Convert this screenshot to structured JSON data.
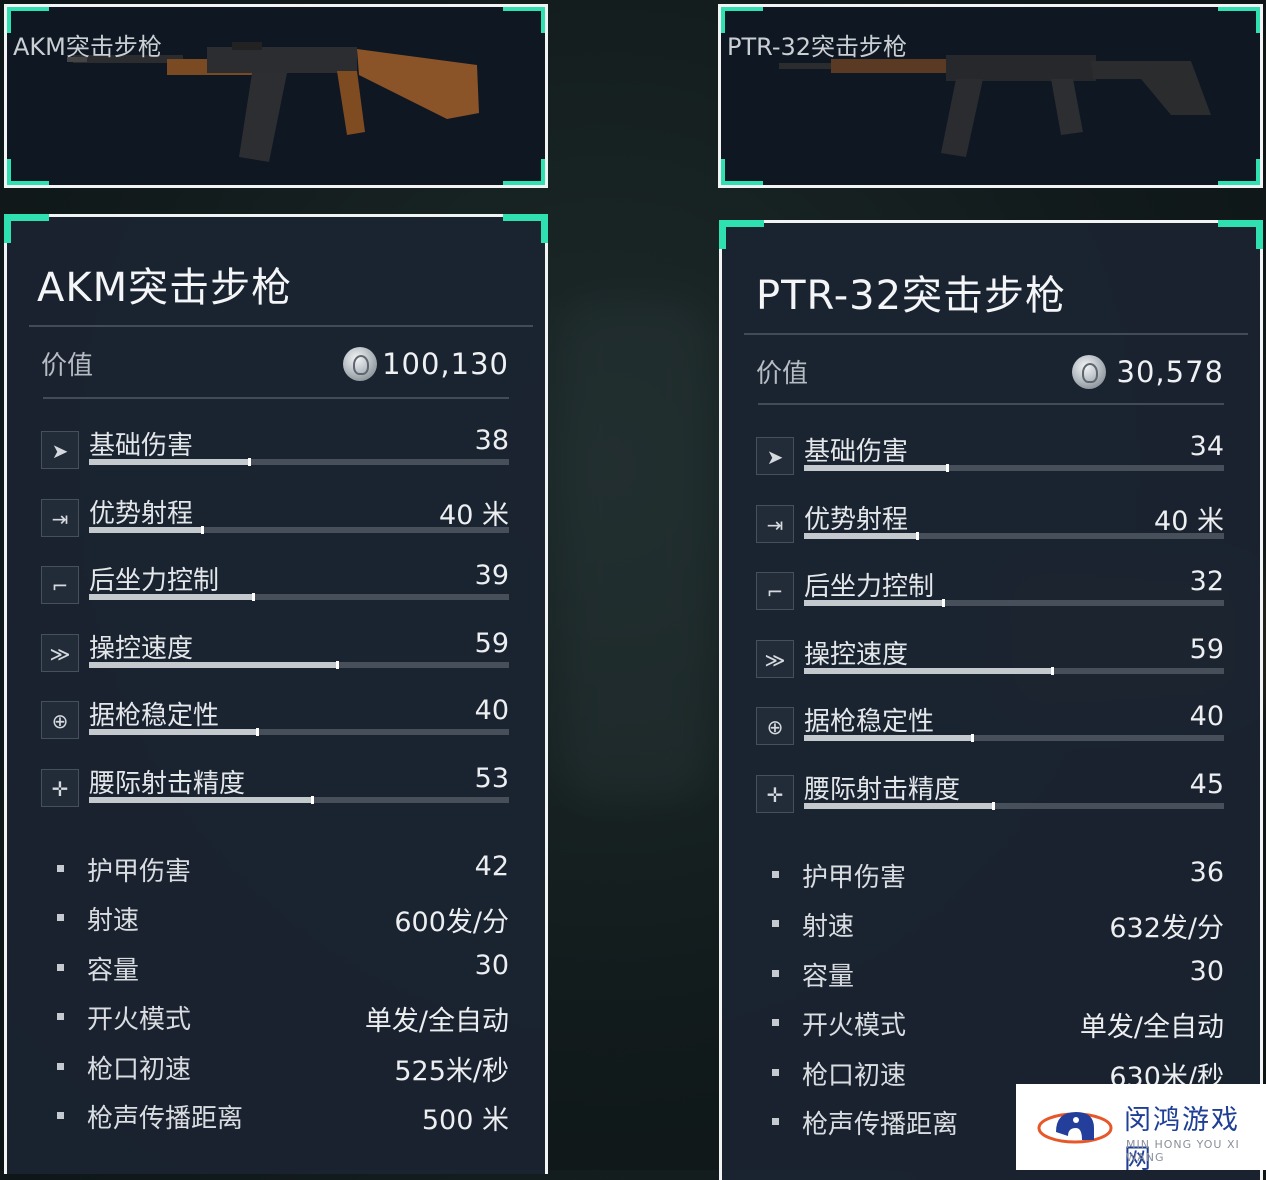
{
  "left": {
    "image_title": "AKM突击步枪",
    "name": "AKM突击步枪",
    "value_label": "价值",
    "value": "100,130",
    "stats": [
      {
        "icon": "damage-icon",
        "label": "基础伤害",
        "value": "38",
        "level": 0.38
      },
      {
        "icon": "range-icon",
        "label": "优势射程",
        "value": "40 米",
        "level": 0.27
      },
      {
        "icon": "recoil-icon",
        "label": "后坐力控制",
        "value": "39",
        "level": 0.39
      },
      {
        "icon": "handling-icon",
        "label": "操控速度",
        "value": "59",
        "level": 0.59
      },
      {
        "icon": "crosshair-icon",
        "label": "据枪稳定性",
        "value": "40",
        "level": 0.4
      },
      {
        "icon": "hipfire-icon",
        "label": "腰际射击精度",
        "value": "53",
        "level": 0.53
      }
    ],
    "attributes": [
      {
        "label": "护甲伤害",
        "value": "42"
      },
      {
        "label": "射速",
        "value": "600发/分"
      },
      {
        "label": "容量",
        "value": "30"
      },
      {
        "label": "开火模式",
        "value": "单发/全自动"
      },
      {
        "label": "枪口初速",
        "value": "525米/秒"
      },
      {
        "label": "枪声传播距离",
        "value": "500 米"
      }
    ]
  },
  "right": {
    "image_title": "PTR-32突击步枪",
    "name": "PTR-32突击步枪",
    "value_label": "价值",
    "value": "30,578",
    "stats": [
      {
        "icon": "damage-icon",
        "label": "基础伤害",
        "value": "34",
        "level": 0.34
      },
      {
        "icon": "range-icon",
        "label": "优势射程",
        "value": "40 米",
        "level": 0.27
      },
      {
        "icon": "recoil-icon",
        "label": "后坐力控制",
        "value": "32",
        "level": 0.33
      },
      {
        "icon": "handling-icon",
        "label": "操控速度",
        "value": "59",
        "level": 0.59
      },
      {
        "icon": "crosshair-icon",
        "label": "据枪稳定性",
        "value": "40",
        "level": 0.4
      },
      {
        "icon": "hipfire-icon",
        "label": "腰际射击精度",
        "value": "45",
        "level": 0.45
      }
    ],
    "attributes": [
      {
        "label": "护甲伤害",
        "value": "36"
      },
      {
        "label": "射速",
        "value": "632发/分"
      },
      {
        "label": "容量",
        "value": "30"
      },
      {
        "label": "开火模式",
        "value": "单发/全自动"
      },
      {
        "label": "枪口初速",
        "value": "630米/秒"
      },
      {
        "label": "枪声传播距离",
        "value": ""
      }
    ]
  },
  "watermark": {
    "name": "闵鸿游戏网",
    "pinyin": "MIN HONG YOU XI WANG"
  },
  "colors": {
    "accent": "#2fe0b0",
    "panel": "#1b2432",
    "bar_fill": "#c4c9ce"
  }
}
